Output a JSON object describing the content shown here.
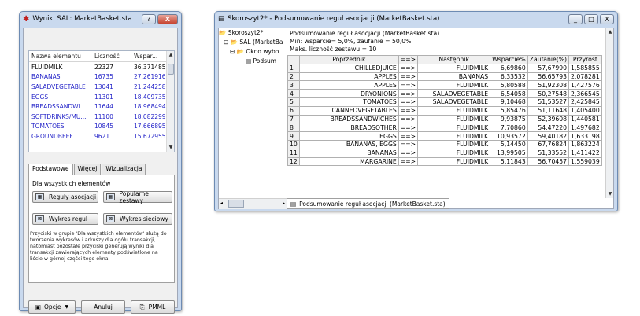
{
  "left_window": {
    "title": "Wyniki SAL: MarketBasket.sta",
    "title_buttons": [
      "?",
      "X"
    ],
    "list": {
      "headers": [
        "Nazwa elementu",
        "Liczność",
        "Wspar..."
      ],
      "rows": [
        [
          "FLUIDMILK",
          "22327",
          "36,371485"
        ],
        [
          "BANANAS",
          "16735",
          "27,261916"
        ],
        [
          "SALADVEGETABLE",
          "13041",
          "21,244258"
        ],
        [
          "EGGS",
          "11301",
          "18,409735"
        ],
        [
          "BREADSSANDWI...",
          "11644",
          "18,968494"
        ],
        [
          "SOFTDRINKS/MU...",
          "11100",
          "18,082299"
        ],
        [
          "TOMATOES",
          "10845",
          "17,666895"
        ],
        [
          "GROUNDBEEF",
          "9621",
          "15,672955"
        ]
      ]
    },
    "tabs": [
      "Podstawowe",
      "Więcej",
      "Wizualizacja"
    ],
    "section_label": "Dla wszystkich elementów",
    "buttons": {
      "rules": "Reguły asocjacji",
      "popular": "Popularne zestawy",
      "rules_chart": "Wykres reguł",
      "network_chart": "Wykres sieciowy"
    },
    "help_text": "Przyciski w grupie 'Dla wszystkich elementów' służą do tworzenia wykresów i arkuszy dla ogółu transakcji, natomiast pozostałe przyciski generują wyniki dla transakcji zawierających elementy  podświetlone na liście w górnej części tego okna.",
    "bottom_buttons": {
      "options": "Opcje",
      "cancel": "Anuluj",
      "pmml": "PMML"
    }
  },
  "right_window": {
    "title": "Skoroszyt2* - Podsumowanie reguł asocjacji (MarketBasket.sta)",
    "title_buttons": [
      "_",
      "□",
      "X"
    ],
    "tree": [
      "Skoroszyt2*",
      "SAL (MarketBa",
      "Okno wybo",
      "Podsum"
    ],
    "sheet_header": [
      "Podsumowanie reguł asocjacji (MarketBasket.sta)",
      "Min: wsparcie= 5,0%, zaufanie = 50,0%",
      "Maks. liczność zestawu = 10"
    ],
    "columns": [
      "",
      "Poprzednik",
      "==>",
      "Następnik",
      "Wsparcie%",
      "Zaufanie(%)",
      "Przyrost"
    ],
    "rows": [
      [
        "1",
        "CHILLEDJUICE",
        "==>",
        "FLUIDMILK",
        "6,69860",
        "57,67990",
        "1,585855"
      ],
      [
        "2",
        "APPLES",
        "==>",
        "BANANAS",
        "6,33532",
        "56,65793",
        "2,078281"
      ],
      [
        "3",
        "APPLES",
        "==>",
        "FLUIDMILK",
        "5,80588",
        "51,92308",
        "1,427576"
      ],
      [
        "4",
        "DRYONIONS",
        "==>",
        "SALADVEGETABLE",
        "6,54058",
        "50,27548",
        "2,366545"
      ],
      [
        "5",
        "TOMATOES",
        "==>",
        "SALADVEGETABLE",
        "9,10468",
        "51,53527",
        "2,425845"
      ],
      [
        "6",
        "CANNEDVEGETABLES",
        "==>",
        "FLUIDMILK",
        "5,85476",
        "51,11648",
        "1,405400"
      ],
      [
        "7",
        "BREADSSANDWICHES",
        "==>",
        "FLUIDMILK",
        "9,93875",
        "52,39608",
        "1,440581"
      ],
      [
        "8",
        "BREADSOTHER",
        "==>",
        "FLUIDMILK",
        "7,70860",
        "54,47220",
        "1,497682"
      ],
      [
        "9",
        "EGGS",
        "==>",
        "FLUIDMILK",
        "10,93572",
        "59,40182",
        "1,633198"
      ],
      [
        "10",
        "BANANAS,  EGGS",
        "==>",
        "FLUIDMILK",
        "5,14450",
        "67,76824",
        "1,863224"
      ],
      [
        "11",
        "BANANAS",
        "==>",
        "FLUIDMILK",
        "13,99505",
        "51,33552",
        "1,411422"
      ],
      [
        "12",
        "MARGARINE",
        "==>",
        "FLUIDMILK",
        "5,11843",
        "56,70457",
        "1,559039"
      ]
    ],
    "sheet_tab": "Podsumowanie reguł asocjacji (MarketBasket.sta)",
    "hscroll_label": "..."
  }
}
